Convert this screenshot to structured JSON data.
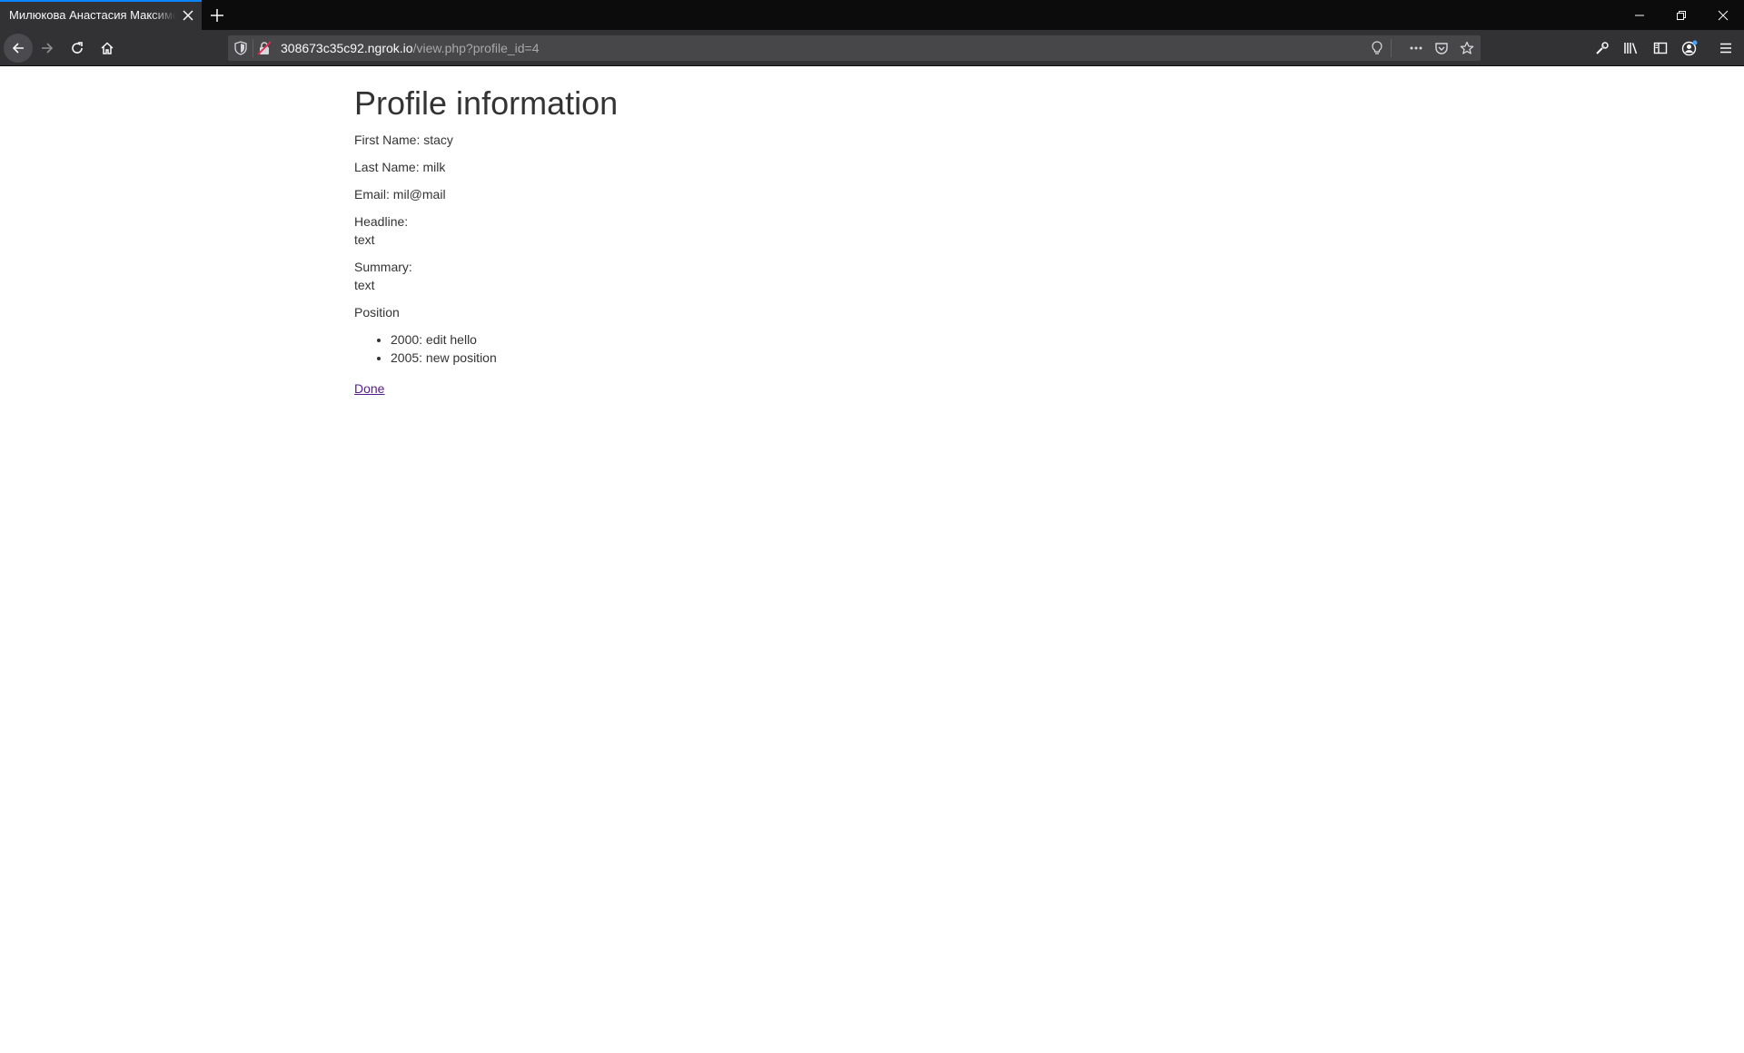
{
  "browser": {
    "tab_title": "Милюкова Анастасия Максимовна",
    "url_host": "308673c35c92.ngrok.io",
    "url_path": "/view.php?profile_id=4",
    "accent_color": "#0a84ff"
  },
  "page": {
    "title": "Profile information",
    "first_name_label": "First Name:",
    "first_name_value": "stacy",
    "last_name_label": "Last Name:",
    "last_name_value": "milk",
    "email_label": "Email:",
    "email_value": "mil@mail",
    "headline_label": "Headline:",
    "headline_value": "text",
    "summary_label": "Summary:",
    "summary_value": "text",
    "position_label": "Position",
    "positions": [
      {
        "text": "2000: edit hello"
      },
      {
        "text": "2005: new position"
      }
    ],
    "done_link": "Done"
  }
}
